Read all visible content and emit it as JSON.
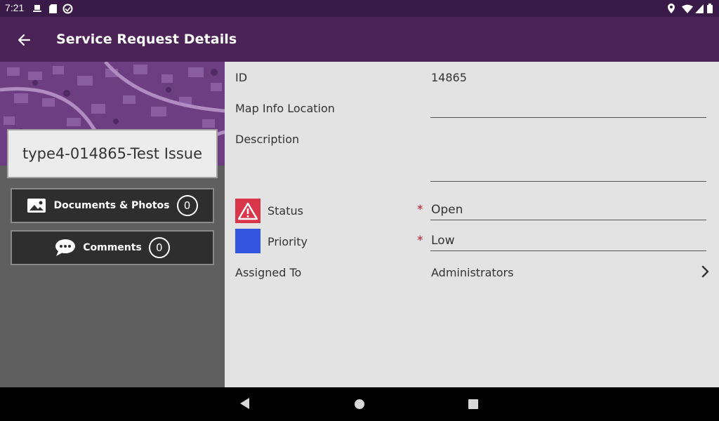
{
  "status_bar": {
    "time": "7:21"
  },
  "app_bar": {
    "title": "Service Request Details",
    "back_icon": "arrow-left-icon"
  },
  "left_panel": {
    "request_title": "type4-014865-Test Issue",
    "documents_button": {
      "label": "Documents & Photos",
      "count": "0",
      "icon": "image-icon"
    },
    "comments_button": {
      "label": "Comments",
      "count": "0",
      "icon": "speech-bubble-icon"
    }
  },
  "details": {
    "id": {
      "label": "ID",
      "value": "14865"
    },
    "map_info_location": {
      "label": "Map Info Location",
      "value": ""
    },
    "description": {
      "label": "Description",
      "value": ""
    },
    "status": {
      "label": "Status",
      "value": "Open",
      "required_mark": "*",
      "icon": "warning-icon",
      "icon_color": "#d93649"
    },
    "priority": {
      "label": "Priority",
      "value": "Low",
      "required_mark": "*",
      "color": "#3355e0"
    },
    "assigned_to": {
      "label": "Assigned To",
      "value": "Administrators",
      "icon": "chevron-right-icon"
    }
  },
  "colors": {
    "app_bar": "#4b2356",
    "status_bar": "#3a1a48",
    "content_bg": "#e3e3e3",
    "left_bg": "#5f5f5f"
  }
}
